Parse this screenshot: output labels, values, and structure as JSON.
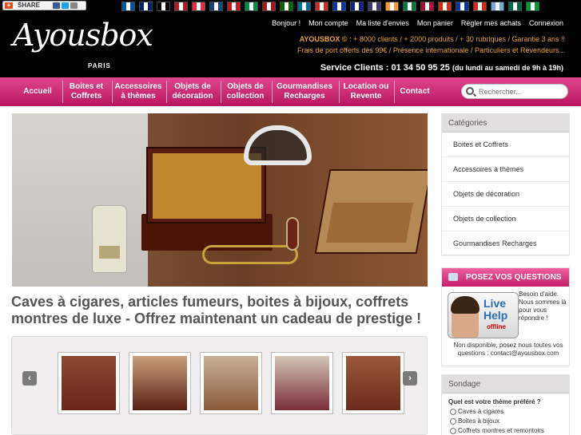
{
  "share": {
    "label": "SHARE"
  },
  "flags": [
    "#0055a4",
    "#012169",
    "#000000",
    "#ae1c28",
    "#ed2939",
    "#11457e",
    "#ce1126",
    "#008c45",
    "#aa151b",
    "#006600",
    "#006aa7",
    "#d52b1e",
    "#0039a6",
    "#12238a",
    "#3c3b6e",
    "#ff9933",
    "#007a3d",
    "#bc002d",
    "#de2910",
    "#0038a8",
    "#de2910",
    "#74acdf",
    "#006847",
    "#009c3b"
  ],
  "logo": {
    "name": "Ayousbox",
    "sub": "PARIS"
  },
  "toplinks": [
    "Bonjour !",
    "Mon compte",
    "Ma liste d'envies",
    "Mon panier",
    "Régler mes achats",
    "Connexion"
  ],
  "promo": {
    "brand": "AYOUSBOX ©",
    "line1": " : + 8000 clients / + 2000 produits / + 30 rubriques / Garantie 3 ans !!",
    "line2": "Frais de port offerts dès 99€ / Présence internationale / Particuliers et Revendeurs..."
  },
  "service": {
    "label": "Service Clients : 01 34 50 95 25",
    "hours": "(du lundi au samedi de 9h à 19h)"
  },
  "nav": [
    {
      "l1": "Accueil",
      "l2": ""
    },
    {
      "l1": "Boites et",
      "l2": "Coffrets"
    },
    {
      "l1": "Accessoires",
      "l2": "à thèmes"
    },
    {
      "l1": "Objets de",
      "l2": "décoration"
    },
    {
      "l1": "Objets de",
      "l2": "collection"
    },
    {
      "l1": "Gourmandises",
      "l2": "Recharges"
    },
    {
      "l1": "Location ou",
      "l2": "Revente"
    },
    {
      "l1": "Contact",
      "l2": ""
    }
  ],
  "search": {
    "placeholder": "Rechercher..."
  },
  "headline": "Caves à cigares, articles fumeurs, boites à bijoux, coffrets montres de luxe - Offrez maintenant un cadeau de prestige !",
  "carousel": {
    "prev": "‹",
    "next": "›",
    "thumbs": [
      "#6b2418",
      "#5a1f14",
      "#8a5a3a",
      "#7a2d3a",
      "#6a2a1a"
    ]
  },
  "categories": {
    "title": "Catégories",
    "items": [
      "Boites et Coffrets",
      "Accessoires à thèmes",
      "Objets de décoration",
      "Objets de collection",
      "Gourmandises Recharges"
    ]
  },
  "questions": {
    "title": "POSEZ VOS QUESTIONS",
    "live": "Live",
    "help": "Help",
    "offline": "offline",
    "text": "Besoin d'aide. Nous sommes là pour vous répondre !",
    "foot": "Non disponible, posez nous toutes vos questions : contact@ayousbox.com"
  },
  "poll": {
    "title": "Sondage",
    "question": "Quel est votre thème préféré ?",
    "options": [
      "Caves à cigares",
      "Boites à bijoux",
      "Coffrets montres et remontoirs"
    ]
  }
}
